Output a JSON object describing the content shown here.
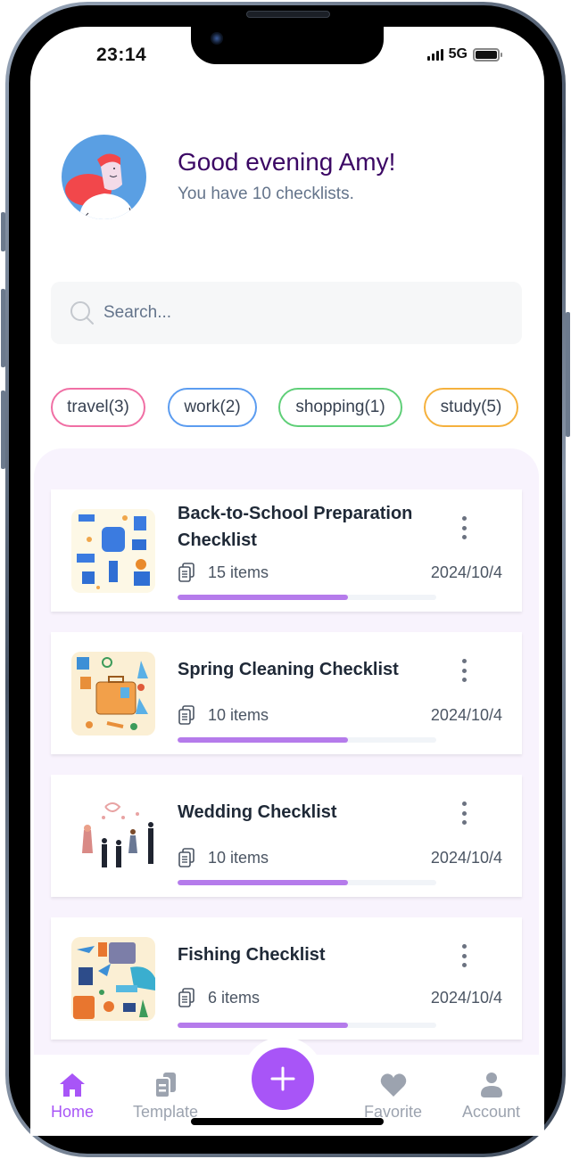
{
  "status_bar": {
    "time": "23:14",
    "network": "5G",
    "icons": [
      "signal-icon",
      "battery-icon"
    ]
  },
  "header": {
    "greeting": "Good evening Amy!",
    "subtitle": "You have 10 checklists.",
    "avatar_icon": "user-avatar-illustration"
  },
  "search": {
    "placeholder": "Search...",
    "value": "",
    "icon": "search-icon"
  },
  "tags": [
    {
      "label": "travel(3)",
      "color": "#f06fa4"
    },
    {
      "label": "work(2)",
      "color": "#5b9cf0"
    },
    {
      "label": "shopping(1)",
      "color": "#5fcf78"
    },
    {
      "label": "study(5)",
      "color": "#f5b13d"
    }
  ],
  "checklists": [
    {
      "title": "Back-to-School Preparation Checklist",
      "items": "15 items",
      "date": "2024/10/4",
      "progress": 0.66,
      "thumbnail": "school-supplies-pattern"
    },
    {
      "title": "Spring Cleaning Checklist",
      "items": "10 items",
      "date": "2024/10/4",
      "progress": 0.66,
      "thumbnail": "travel-suitcase-pattern"
    },
    {
      "title": "Wedding Checklist",
      "items": "10 items",
      "date": "2024/10/4",
      "progress": 0.66,
      "thumbnail": "wedding-guests-illustration"
    },
    {
      "title": "Fishing Checklist",
      "items": "6 items",
      "date": "2024/10/4",
      "progress": 0.66,
      "thumbnail": "travel-items-pattern"
    }
  ],
  "nav": {
    "items": [
      {
        "label": "Home",
        "icon": "home-icon",
        "active": true
      },
      {
        "label": "Template",
        "icon": "template-icon",
        "active": false
      },
      {
        "label": "Favorite",
        "icon": "heart-icon",
        "active": false
      },
      {
        "label": "Account",
        "icon": "account-icon",
        "active": false
      }
    ],
    "fab_icon": "plus-icon"
  },
  "colors": {
    "accent": "#a855f7",
    "greeting": "#3b0764",
    "progress": "#b57beb",
    "panel_bg": "#f8f3fd"
  }
}
